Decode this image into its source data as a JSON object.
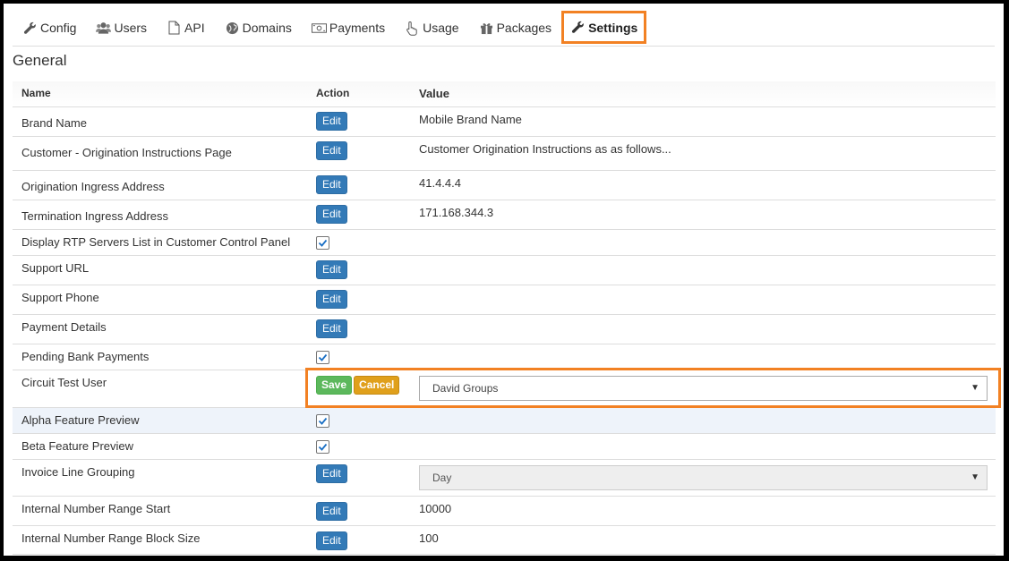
{
  "tabs": [
    {
      "label": "Config",
      "icon": "wrench-icon"
    },
    {
      "label": "Users",
      "icon": "users-icon"
    },
    {
      "label": "API",
      "icon": "document-icon"
    },
    {
      "label": "Domains",
      "icon": "globe-icon"
    },
    {
      "label": "Payments",
      "icon": "money-icon"
    },
    {
      "label": "Usage",
      "icon": "hand-pointer-icon"
    },
    {
      "label": "Packages",
      "icon": "gift-icon"
    },
    {
      "label": "Settings",
      "icon": "wrench-icon",
      "active": true
    }
  ],
  "section_title": "General",
  "table": {
    "headers": {
      "name": "Name",
      "action": "Action",
      "value": "Value"
    },
    "edit_label": "Edit",
    "save_label": "Save",
    "cancel_label": "Cancel",
    "rows": [
      {
        "name": "Brand Name",
        "action": "edit",
        "value": "Mobile Brand Name"
      },
      {
        "name": "Customer - Origination Instructions Page",
        "action": "edit",
        "value": "Customer Origination Instructions as as follows..."
      },
      {
        "name": "Origination Ingress Address",
        "action": "edit",
        "value": "41.4.4.4"
      },
      {
        "name": "Termination Ingress Address",
        "action": "edit",
        "value": "171.168.344.3"
      },
      {
        "name": "Display RTP Servers List in Customer Control Panel",
        "action": "checkbox",
        "checked": true,
        "value": ""
      },
      {
        "name": "Support URL",
        "action": "edit",
        "value": ""
      },
      {
        "name": "Support Phone",
        "action": "edit",
        "value": ""
      },
      {
        "name": "Payment Details",
        "action": "edit",
        "value": ""
      },
      {
        "name": "Pending Bank Payments",
        "action": "checkbox",
        "checked": true,
        "value": ""
      },
      {
        "name": "Circuit Test User",
        "action": "save-cancel",
        "value": "David Groups",
        "value_type": "select"
      },
      {
        "name": "Alpha Feature Preview",
        "action": "checkbox",
        "checked": true,
        "value": "",
        "highlight": true
      },
      {
        "name": "Beta Feature Preview",
        "action": "checkbox",
        "checked": true,
        "value": ""
      },
      {
        "name": "Invoice Line Grouping",
        "action": "edit",
        "value": "Day",
        "value_type": "select-disabled"
      },
      {
        "name": "Internal Number Range Start",
        "action": "edit",
        "value": "10000"
      },
      {
        "name": "Internal Number Range Block Size",
        "action": "edit",
        "value": "100"
      }
    ]
  },
  "colors": {
    "accent_outline": "#f28123",
    "edit_button": "#337ab7",
    "save_button": "#5cb85c",
    "cancel_button": "#e0a01b"
  }
}
